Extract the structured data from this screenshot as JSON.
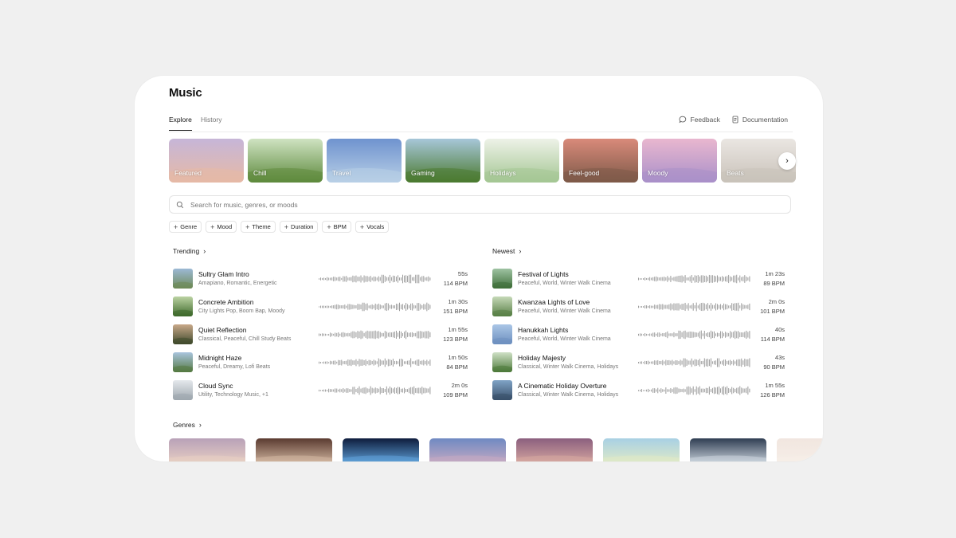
{
  "app": {
    "title": "Music"
  },
  "tabs": [
    {
      "label": "Explore",
      "active": true
    },
    {
      "label": "History",
      "active": false
    }
  ],
  "top_links": {
    "feedback": "Feedback",
    "documentation": "Documentation"
  },
  "categories": [
    {
      "label": "Featured",
      "colors": [
        "#c6b6d8",
        "#e6b9a6"
      ]
    },
    {
      "label": "Chill",
      "colors": [
        "#cfe3c2",
        "#5e8a3d"
      ]
    },
    {
      "label": "Travel",
      "colors": [
        "#6f93cf",
        "#b8cfe6"
      ]
    },
    {
      "label": "Gaming",
      "colors": [
        "#a7c7d9",
        "#4b7a2f"
      ]
    },
    {
      "label": "Holidays",
      "colors": [
        "#eef2e8",
        "#a4c693"
      ]
    },
    {
      "label": "Feel-good",
      "colors": [
        "#d98a7a",
        "#7e5a49"
      ]
    },
    {
      "label": "Moody",
      "colors": [
        "#e9b7cf",
        "#a990c9"
      ]
    },
    {
      "label": "Beats",
      "colors": [
        "#eae6e2",
        "#c9c2b9"
      ]
    }
  ],
  "search": {
    "placeholder": "Search for music, genres, or moods"
  },
  "filters": [
    "Genre",
    "Mood",
    "Theme",
    "Duration",
    "BPM",
    "Vocals"
  ],
  "trending": {
    "heading": "Trending",
    "items": [
      {
        "title": "Sultry Glam Intro",
        "tags": "Amapiano, Romantic, Energetic",
        "duration": "55s",
        "bpm": "114 BPM",
        "colors": [
          "#9cb9d6",
          "#6e8a58"
        ]
      },
      {
        "title": "Concrete Ambition",
        "tags": "City Lights Pop, Boom Bap, Moody",
        "duration": "1m 30s",
        "bpm": "151 BPM",
        "colors": [
          "#bcd3a3",
          "#3e6a2c"
        ]
      },
      {
        "title": "Quiet Reflection",
        "tags": "Classical, Peaceful, Chill Study Beats",
        "duration": "1m 55s",
        "bpm": "123 BPM",
        "colors": [
          "#c9a98a",
          "#3f4a2c"
        ]
      },
      {
        "title": "Midnight Haze",
        "tags": "Peaceful, Dreamy, Lofi Beats",
        "duration": "1m 50s",
        "bpm": "84 BPM",
        "colors": [
          "#a9c4de",
          "#557a43"
        ]
      },
      {
        "title": "Cloud Sync",
        "tags": "Utility, Technology Music, +1",
        "duration": "2m 0s",
        "bpm": "109 BPM",
        "colors": [
          "#e4e8ec",
          "#9ea7ae"
        ]
      }
    ]
  },
  "newest": {
    "heading": "Newest",
    "items": [
      {
        "title": "Festival of Lights",
        "tags": "Peaceful, World, Winter Walk Cinema",
        "duration": "1m 23s",
        "bpm": "89 BPM",
        "colors": [
          "#9fc3a3",
          "#3f6f3a"
        ]
      },
      {
        "title": "Kwanzaa Lights of Love",
        "tags": "Peaceful, World, Winter Walk Cinema",
        "duration": "2m 0s",
        "bpm": "101 BPM",
        "colors": [
          "#c6d9b8",
          "#587f46"
        ]
      },
      {
        "title": "Hanukkah Lights",
        "tags": "Peaceful, World, Winter Walk Cinema",
        "duration": "40s",
        "bpm": "114 BPM",
        "colors": [
          "#aac6e6",
          "#6d8fbf"
        ]
      },
      {
        "title": "Holiday Majesty",
        "tags": "Classical, Winter Walk Cinema, Holidays",
        "duration": "43s",
        "bpm": "90 BPM",
        "colors": [
          "#cfe0c6",
          "#4d7a3a"
        ]
      },
      {
        "title": "A Cinematic Holiday Overture",
        "tags": "Classical, Winter Walk Cinema, Holidays",
        "duration": "1m 55s",
        "bpm": "126 BPM",
        "colors": [
          "#7fa3c6",
          "#39506a"
        ]
      }
    ]
  },
  "genres": {
    "heading": "Genres",
    "items": [
      {
        "colors": [
          "#b8a1b8",
          "#e8cfc3"
        ]
      },
      {
        "colors": [
          "#5a3a30",
          "#d1b6a0"
        ]
      },
      {
        "colors": [
          "#0e1c3c",
          "#5fa0d8"
        ]
      },
      {
        "colors": [
          "#6f89c2",
          "#c5a9c2"
        ]
      },
      {
        "colors": [
          "#8b5f7e",
          "#d6a7a0"
        ]
      },
      {
        "colors": [
          "#a8d0e4",
          "#e0eac6"
        ]
      },
      {
        "colors": [
          "#2f3d52",
          "#cad3dc"
        ]
      },
      {
        "colors": [
          "#f1e6df",
          "#f6eee8"
        ]
      }
    ]
  }
}
